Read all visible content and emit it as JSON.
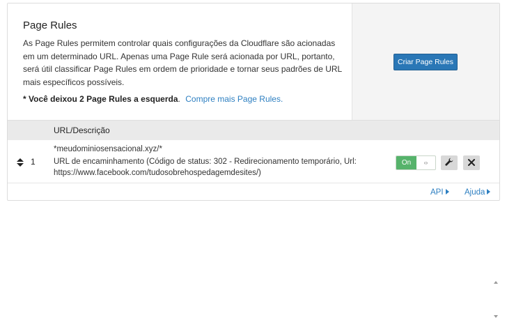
{
  "header": {
    "title": "Page Rules",
    "description": "As Page Rules permitem controlar quais configurações da Cloudflare são acionadas em um determinado URL. Apenas uma Page Rule será acionada por URL, portanto, será útil classificar Page Rules em ordem de prioridade e tornar seus padrões de URL mais específicos possíveis.",
    "remaining_text": "* Você deixou 2 Page Rules a esquerda",
    "remaining_period": ".",
    "buy_more_link": "Compre mais Page Rules.",
    "create_button": "Criar Page Rules"
  },
  "table": {
    "column_header": "URL/Descrição",
    "rows": [
      {
        "priority": "1",
        "url": "*meudominiosensacional.xyz/*",
        "description_line1": "URL de encaminhamento (Código de status: 302 - Redirecionamento temporário, Url:",
        "description_line2": "https://www.facebook.com/tudosobrehospedagemdesites/)",
        "toggle_label": "On",
        "toggle_knob": "‹›",
        "enabled": true
      }
    ]
  },
  "footer": {
    "api_link": "API",
    "help_link": "Ajuda"
  },
  "colors": {
    "primary_button": "#2a77b6",
    "toggle_on": "#56b36b",
    "link": "#2d7fc1"
  }
}
